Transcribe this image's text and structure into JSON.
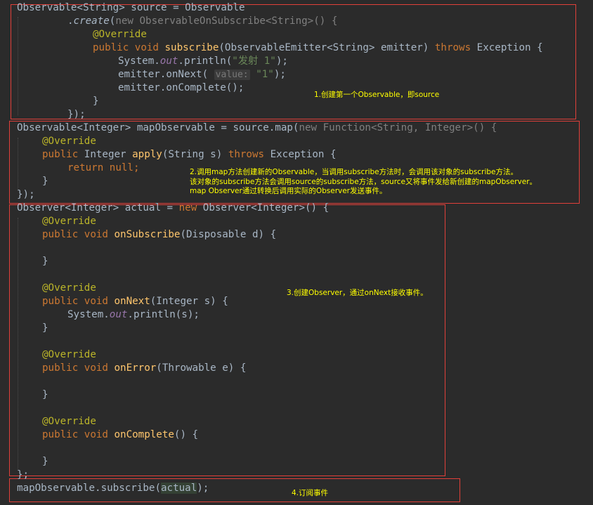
{
  "code": {
    "l1": [
      "Observable<String> source = Observable"
    ],
    "l2": [
      ".",
      "create",
      "(",
      "new ObservableOnSubscribe<String>() {"
    ],
    "l3": [
      "@Override"
    ],
    "l4": [
      "public void ",
      "subscribe",
      "(ObservableEmitter<String> emitter) ",
      "throws",
      " Exception {"
    ],
    "l5": [
      "System.",
      "out",
      ".println(",
      "\"发射 1\"",
      ");"
    ],
    "l6": [
      "emitter.onNext( ",
      "value:",
      " ",
      "\"1\"",
      ");"
    ],
    "l7": [
      "emitter.onComplete();"
    ],
    "l8": [
      "}"
    ],
    "l9": [
      "});"
    ],
    "l10": [
      "Observable<Integer> mapObservable = source.map(",
      "new Function<String, Integer>() {"
    ],
    "l11": [
      "@Override"
    ],
    "l12": [
      "public",
      " Integer ",
      "apply",
      "(String s) ",
      "throws",
      " Exception {"
    ],
    "l13": [
      "return null",
      ";"
    ],
    "l14": [
      "}"
    ],
    "l15": [
      "});"
    ],
    "l16": [
      "Observer<Integer> actual = ",
      "new",
      " Observer<Integer>() {"
    ],
    "l17": [
      "@Override"
    ],
    "l18": [
      "public void ",
      "onSubscribe",
      "(Disposable d) {"
    ],
    "l19": [
      "}"
    ],
    "l20": [
      "@Override"
    ],
    "l21": [
      "public void ",
      "onNext",
      "(Integer s) {"
    ],
    "l22": [
      "System.",
      "out",
      ".println(s);"
    ],
    "l23": [
      "}"
    ],
    "l24": [
      "@Override"
    ],
    "l25": [
      "public void ",
      "onError",
      "(Throwable e) {"
    ],
    "l26": [
      "}"
    ],
    "l27": [
      "@Override"
    ],
    "l28": [
      "public void ",
      "onComplete",
      "() {"
    ],
    "l29": [
      "}"
    ],
    "l30": [
      "};"
    ],
    "l31": [
      "mapObservable.subscribe(",
      "actual",
      ");"
    ]
  },
  "notes": {
    "n1": "1.创建第一个Observable，即source",
    "n2": "2.调用map方法创建新的Observable，当调用subscribe方法时，会调用该对象的subscribe方法。\n该对象的subscribe方法会调用source的subscribe方法，source又将事件发给新创建的mapObserver。\nmap Observer通过转换后调用实际的Observer发送事件。",
    "n3": "3.创建Observer，通过onNext接收事件。",
    "n4": "4.订阅事件"
  },
  "colors": {
    "background": "#2b2b2b",
    "box_border": "#e0403a",
    "note_text": "#ffff00",
    "keyword": "#cc7832",
    "annotation": "#bbb529",
    "method": "#ffc66d",
    "string": "#6a8759",
    "field": "#9876aa"
  }
}
